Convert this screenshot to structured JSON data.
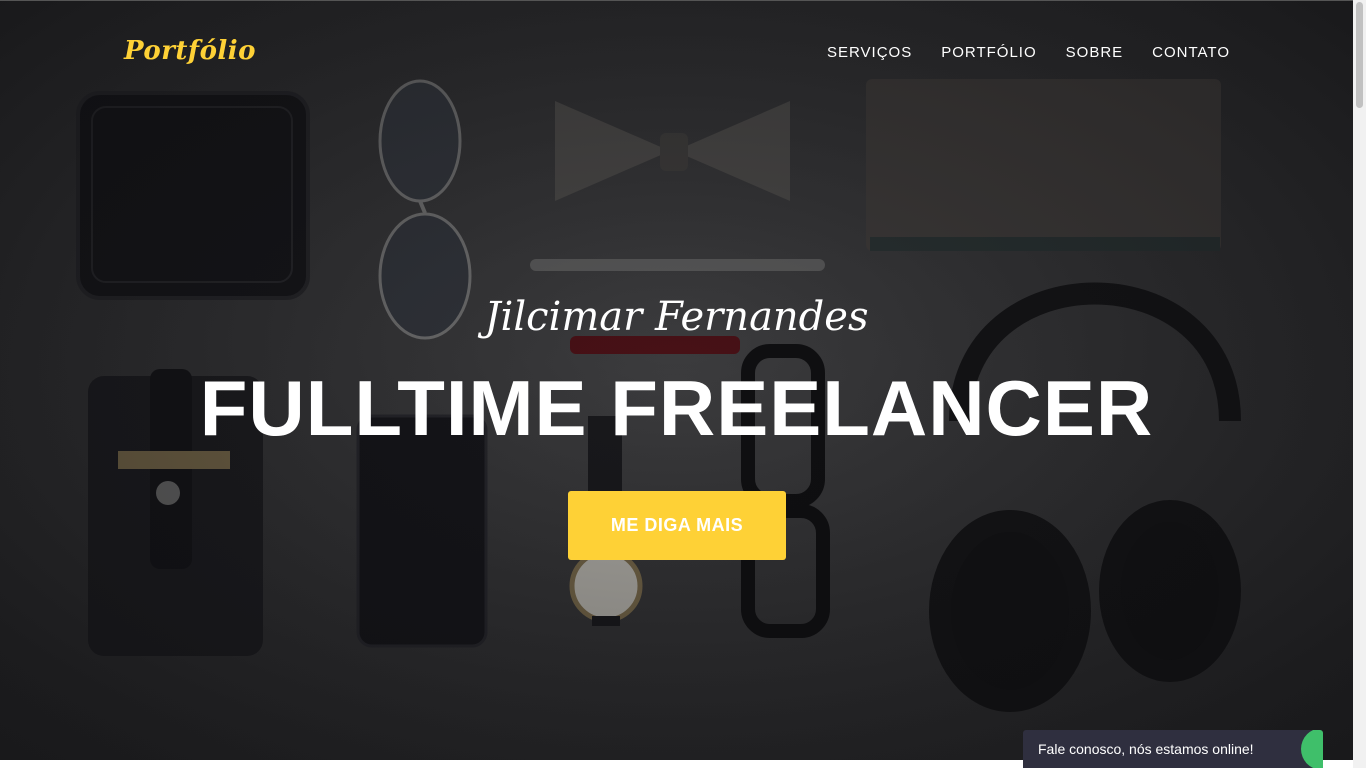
{
  "header": {
    "brand": "Portfólio",
    "nav": [
      {
        "label": "SERVIÇOS"
      },
      {
        "label": "PORTFÓLIO"
      },
      {
        "label": "SOBRE"
      },
      {
        "label": "CONTATO"
      }
    ]
  },
  "hero": {
    "subtitle": "Jilcimar Fernandes",
    "headline": "FULLTIME FREELANCER",
    "cta_label": "ME DIGA MAIS"
  },
  "chat": {
    "text": "Fale conosco, nós estamos online!"
  },
  "colors": {
    "accent": "#fed136",
    "chat_bg": "#2f2f3f",
    "online": "#3fbf6a"
  }
}
